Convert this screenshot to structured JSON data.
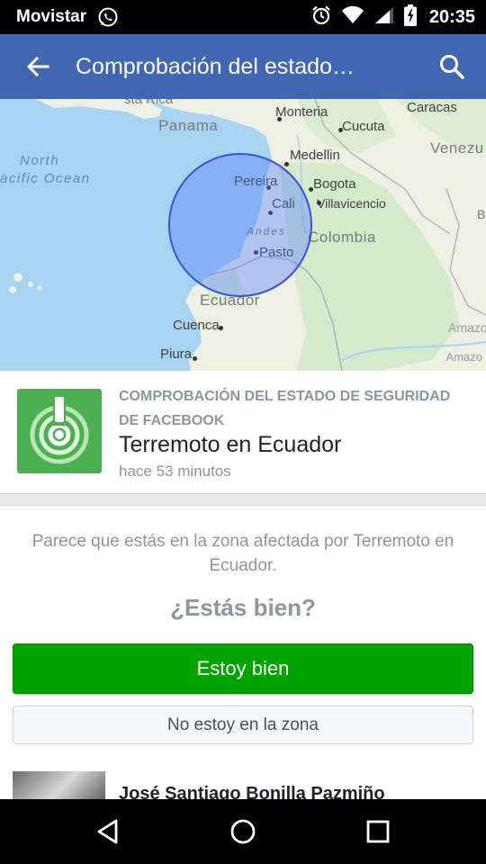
{
  "status_bar": {
    "carrier": "Movistar",
    "time": "20:35",
    "icons": [
      "whatsapp-icon",
      "alarm-icon",
      "wifi-icon",
      "signal-icon",
      "battery-icon"
    ]
  },
  "app_bar": {
    "title": "Comprobación del estado…",
    "back_icon": "back-arrow-icon",
    "search_icon": "search-icon",
    "color": "#4267b2"
  },
  "map": {
    "labels": {
      "costa_rica": "sta Rica",
      "panama": "Panama",
      "monteria": "Monteria",
      "cucuta": "Cucuta",
      "caracas": "Caracas",
      "medellin": "Medellin",
      "venezuela": "Venezu",
      "north_pacific_1": "North",
      "north_pacific_2": "acific Ocean",
      "pereira": "Pereira",
      "bogota": "Bogota",
      "villavicencio": "Villavicencio",
      "cali": "Cali",
      "andes": "Andes",
      "colombia": "Colombia",
      "pasto": "Pasto",
      "ecuador": "Ecuador",
      "cuenca": "Cuenca",
      "piura": "Piura",
      "b": "B",
      "amazon_1": "Amazon",
      "amazon_2": "Amazo"
    },
    "affected_area_color": "#3b4fe0"
  },
  "card": {
    "icon": "safety-check-icon",
    "overline": "COMPROBACIÓN DEL ESTADO DE SEGURIDAD DE FACEBOOK",
    "title": "Terremoto en Ecuador",
    "time": "hace 53 minutos"
  },
  "prompt": "Parece que estás en la zona afectada por Terremoto en Ecuador.",
  "question": "¿Estás bien?",
  "buttons": {
    "ok": "Estoy bien",
    "not_in_area": "No estoy en la zona",
    "ok_color": "#00a400"
  },
  "friend": {
    "name": "José Santiago Bonilla Pazmiño"
  },
  "nav_bar": {
    "back_icon": "nav-back-icon",
    "home_icon": "nav-home-icon",
    "recents_icon": "nav-recents-icon"
  }
}
